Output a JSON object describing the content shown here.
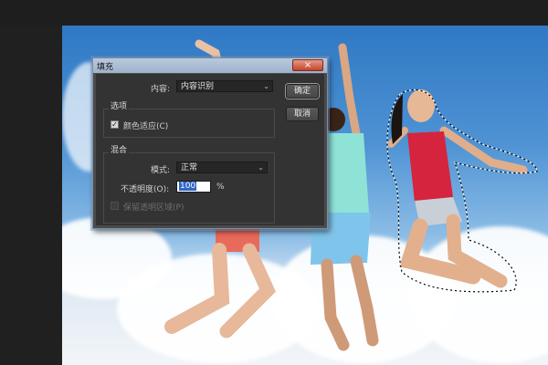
{
  "dialog": {
    "title": "填充",
    "close_icon": "×",
    "content_label": "内容:",
    "content_value": "内容识别",
    "ok_label": "确定",
    "cancel_label": "取消",
    "options_group": "选项",
    "color_adapt_label": "颜色适应(C)",
    "color_adapt_checked": true,
    "blend_group": "混合",
    "mode_label": "模式:",
    "mode_value": "正常",
    "opacity_label": "不透明度(O):",
    "opacity_value": "100",
    "opacity_unit": "%",
    "preserve_transparency_label": "保留透明区域(P)",
    "preserve_transparency_checked": false
  },
  "icons": {
    "dropdown": "chevron-down-icon",
    "check": "check-icon",
    "close": "close-icon"
  },
  "colors": {
    "accent_selection": "#2f67c7",
    "close_button": "#c4442a",
    "dialog_border": "#7b8fa8"
  }
}
